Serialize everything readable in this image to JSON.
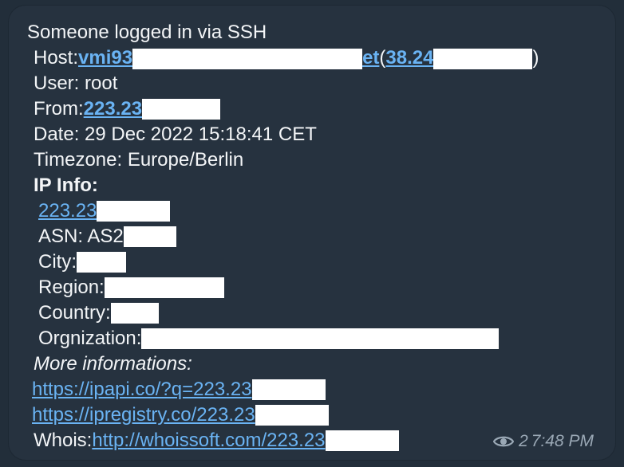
{
  "message": {
    "title": "Someone logged in via SSH",
    "host": {
      "label": "Host: ",
      "hostname_start": "vmi93",
      "hostname_end": "et",
      "paren_open": " (",
      "ip_start": "38.24",
      "paren_close": ")"
    },
    "user": "User: root",
    "from": {
      "label": "From: ",
      "ip_start": "223.23"
    },
    "date": "Date: 29 Dec 2022 15:18:41 CET",
    "timezone": "Timezone: Europe/Berlin",
    "ip_info_heading": "IP Info:",
    "ip_info": {
      "ip_start": "223.23",
      "asn_label": "ASN: AS2",
      "city_label": "City: ",
      "region_label": "Region: ",
      "country_label": "Country: ",
      "organization_label": "Orgnization: "
    },
    "more_info_heading": "More informations:",
    "links": {
      "ipapi": "https://ipapi.co/?q=223.23",
      "ipregistry": "https://ipregistry.co/223.23",
      "whois_label": "Whois: ",
      "whois": "http://whoissoft.com/223.23"
    }
  },
  "footer": {
    "views_icon": "eye-icon",
    "views": "2",
    "time": "7:48 PM"
  },
  "colors": {
    "background": "#222e3a",
    "bubble": "#26323f",
    "text": "#f3f5f7",
    "link": "#6ab3f3",
    "meta": "#9aa8b5",
    "redaction": "#ffffff"
  }
}
